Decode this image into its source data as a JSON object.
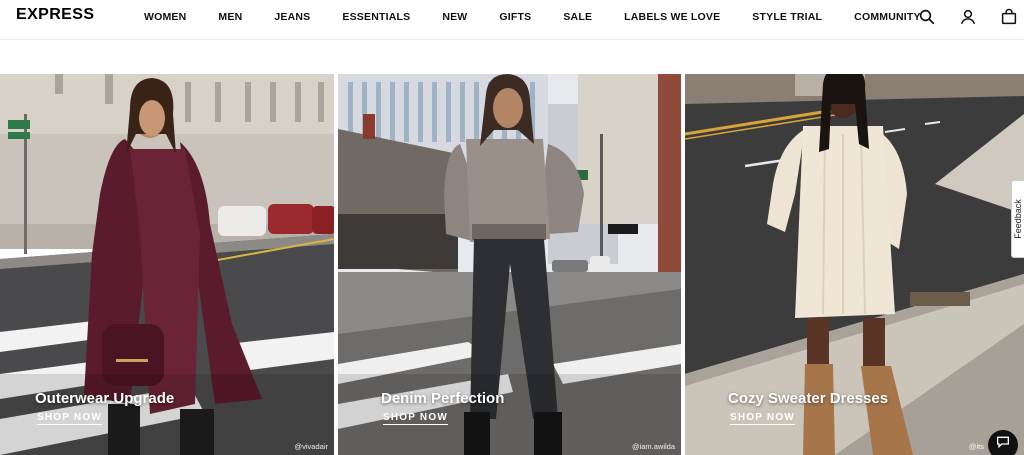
{
  "brand": {
    "logo_text": "EXPRESS"
  },
  "nav": {
    "items": [
      {
        "id": "women",
        "label": "WOMEN"
      },
      {
        "id": "men",
        "label": "MEN"
      },
      {
        "id": "jeans",
        "label": "JEANS"
      },
      {
        "id": "essentials",
        "label": "ESSENTIALS"
      },
      {
        "id": "new",
        "label": "NEW"
      },
      {
        "id": "gifts",
        "label": "GIFTS"
      },
      {
        "id": "sale",
        "label": "SALE"
      },
      {
        "id": "labels-we-love",
        "label": "LABELS WE LOVE"
      },
      {
        "id": "style-trial",
        "label": "STYLE TRIAL"
      },
      {
        "id": "community",
        "label": "COMMUNITY"
      }
    ]
  },
  "header_icons": [
    "search-icon",
    "account-icon",
    "shopping-bag-icon"
  ],
  "panels": [
    {
      "title": "Outerwear Upgrade",
      "cta": "SHOP NOW",
      "handle": "@vivadair"
    },
    {
      "title": "Denim Perfection",
      "cta": "SHOP NOW",
      "handle": "@iam.awilda"
    },
    {
      "title": "Cozy Sweater Dresses",
      "cta": "SHOP NOW",
      "handle": "@its"
    }
  ],
  "feedback": {
    "label": "Feedback"
  },
  "colors": {
    "header_bg": "#ffffff",
    "text": "#111111",
    "overlay_text": "#ffffff",
    "chat_button": "#111111"
  }
}
